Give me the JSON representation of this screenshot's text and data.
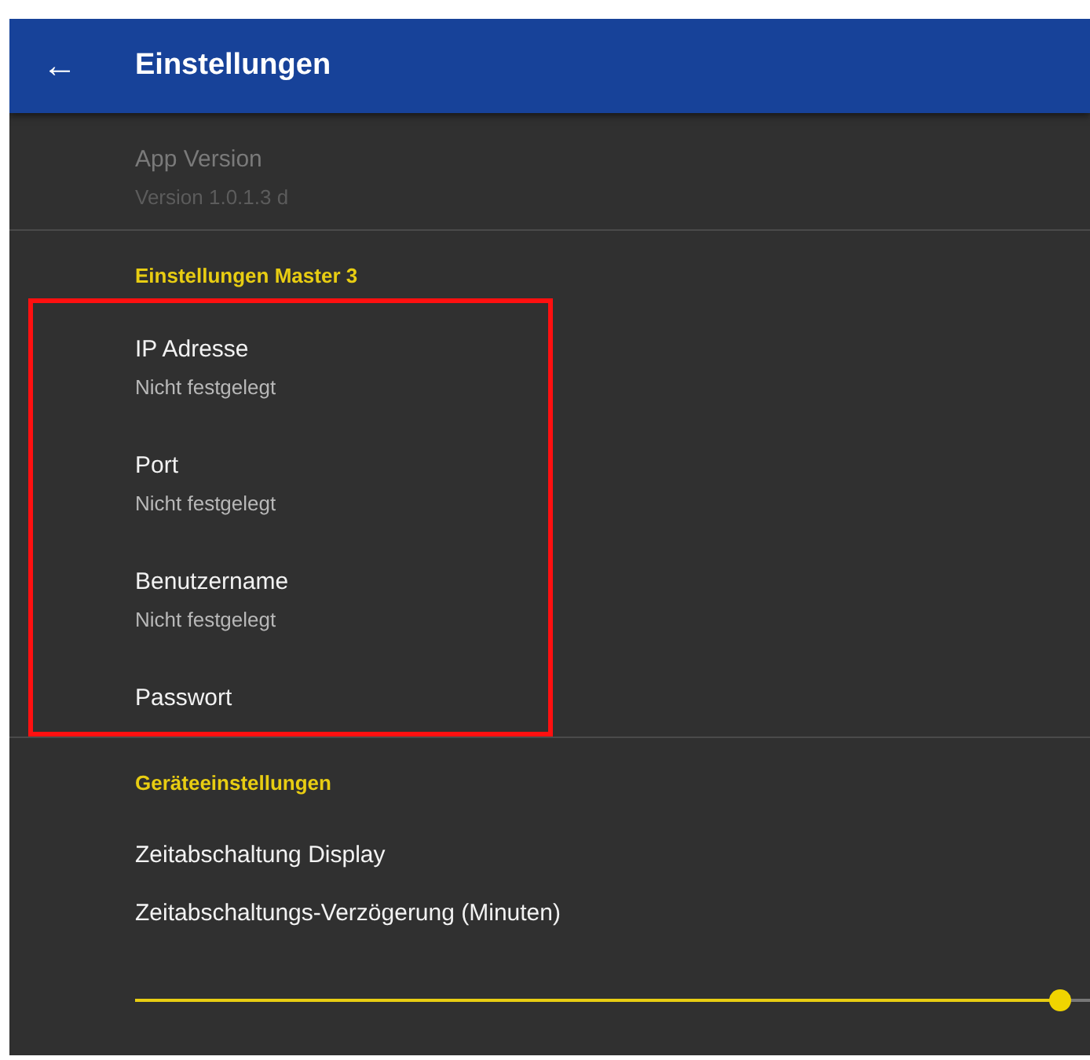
{
  "app_bar": {
    "back_icon": "←",
    "title": "Einstellungen"
  },
  "sections": [
    {
      "items": [
        {
          "kind": "pref",
          "title": "App Version",
          "summary": "Version 1.0.1.3 d",
          "disabled": true
        }
      ]
    },
    {
      "header": "Einstellungen Master 3",
      "highlighted": true,
      "items": [
        {
          "kind": "pref",
          "title": "IP Adresse",
          "summary": "Nicht festgelegt",
          "disabled": false
        },
        {
          "kind": "pref",
          "title": "Port",
          "summary": "Nicht festgelegt",
          "disabled": false
        },
        {
          "kind": "pref",
          "title": "Benutzername",
          "summary": "Nicht festgelegt",
          "disabled": false
        },
        {
          "kind": "pref",
          "title": "Passwort",
          "disabled": false
        }
      ]
    },
    {
      "header": "Geräteeinstellungen",
      "items": [
        {
          "kind": "pref",
          "title": "Zeitabschaltung Display",
          "disabled": false
        },
        {
          "kind": "slider",
          "title": "Zeitabschaltungs-Verzögerung (Minuten)",
          "level": 0.97,
          "disabled": false
        }
      ]
    }
  ]
}
